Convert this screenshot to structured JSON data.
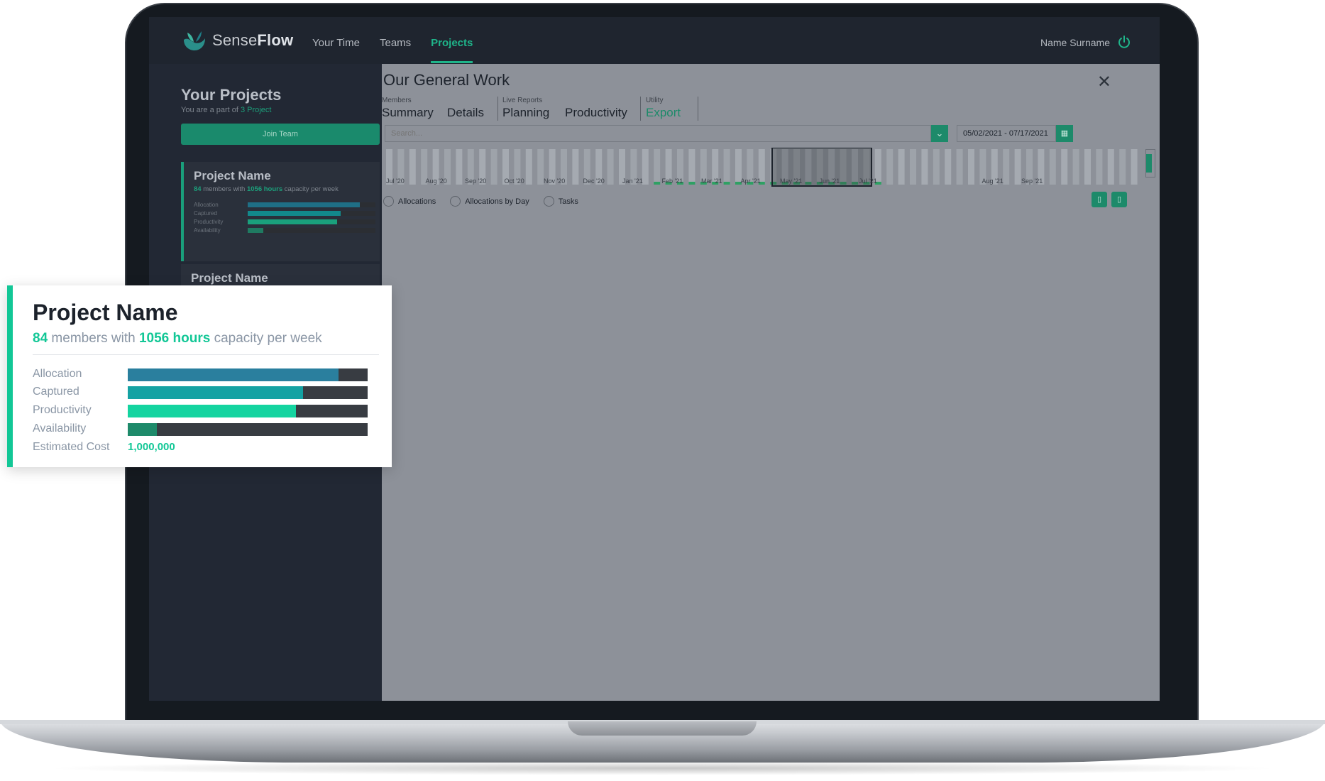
{
  "app": {
    "logo_light": "Sense",
    "logo_bold": "Flow"
  },
  "nav": {
    "items": [
      {
        "label": "Your Time"
      },
      {
        "label": "Teams"
      },
      {
        "label": "Projects"
      }
    ],
    "active": "Projects",
    "user_name": "Name Surname"
  },
  "sidebar": {
    "title": "Your Projects",
    "subtitle_prefix": "You are a part of",
    "subtitle_count": "3 Project",
    "join_button": "Join Team",
    "cards": [
      {
        "title": "Project Name",
        "members": "84",
        "members_text": "members with",
        "hours": "1056 hours",
        "hours_text": "capacity per week",
        "metrics": [
          {
            "label": "Allocation",
            "fraction": 0.88,
            "color": "#1f6f86"
          },
          {
            "label": "Captured",
            "fraction": 0.73,
            "color": "#12898c"
          },
          {
            "label": "Productivity",
            "fraction": 0.7,
            "color": "#1aa07c"
          },
          {
            "label": "Availability",
            "fraction": 0.12,
            "color": "#1f7a61"
          }
        ]
      },
      {
        "title": "Project Name"
      }
    ]
  },
  "panel": {
    "title": "Our General Work",
    "tab_groups": [
      {
        "label": "Members",
        "tabs": [
          "Summary",
          "Details"
        ]
      },
      {
        "label": "Live Reports",
        "tabs": [
          "Planning",
          "Productivity"
        ]
      },
      {
        "label": "Utility",
        "tabs": [
          "Export"
        ]
      }
    ],
    "search_placeholder": "Search...",
    "date_range": "05/02/2021 - 07/17/2021",
    "timeline_labels": [
      "Jul '20",
      "Aug '20",
      "Sep '20",
      "Oct '20",
      "Nov '20",
      "Dec '20",
      "Jan '21",
      "Feb '21",
      "Mar '21",
      "Apr '21",
      "May '21",
      "Jun '21",
      "Jul '21",
      "Aug '21",
      "Sep '21"
    ],
    "radio_options": [
      "Allocations",
      "Allocations by Day",
      "Tasks"
    ]
  },
  "zoom_card": {
    "title": "Project Name",
    "members": "84",
    "members_text": "members with",
    "hours": "1056 hours",
    "hours_text": "capacity per week",
    "metrics": [
      {
        "label": "Allocation",
        "fraction": 0.88,
        "color": "#2a7f9e"
      },
      {
        "label": "Captured",
        "fraction": 0.73,
        "color": "#14a2a3"
      },
      {
        "label": "Productivity",
        "fraction": 0.7,
        "color": "#14d4a0"
      },
      {
        "label": "Availability",
        "fraction": 0.12,
        "color": "#1e8a6a"
      }
    ],
    "cost_label": "Estimated Cost",
    "cost_value": "1,000,000"
  },
  "colors": {
    "accent": "#12c796",
    "brand_dark": "#1d8a6a"
  }
}
